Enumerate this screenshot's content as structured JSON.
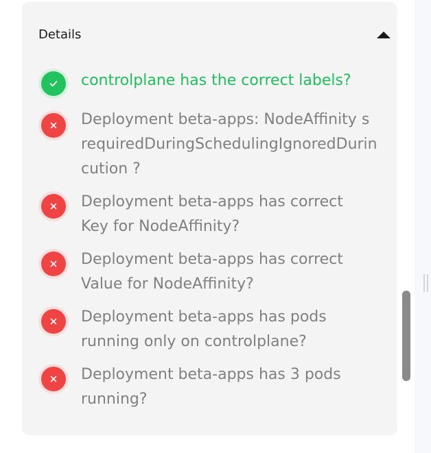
{
  "details": {
    "title": "Details",
    "toggle_icon": "caret-up-icon",
    "colors": {
      "panel_bg": "#f4f4f4",
      "pass": "#22c35e",
      "fail": "#ee4444",
      "muted_text": "#808080"
    },
    "checks": [
      {
        "status": "pass",
        "icon": "check-icon",
        "lines": [
          "controlplane has the correct labels?"
        ]
      },
      {
        "status": "fail",
        "icon": "close-icon",
        "lines": [
          "Deployment beta-apps: NodeAffinity s",
          "requiredDuringSchedulingIgnoredDurin",
          "cution ?"
        ]
      },
      {
        "status": "fail",
        "icon": "close-icon",
        "lines": [
          "Deployment beta-apps has correct",
          "Key for NodeAffinity?"
        ]
      },
      {
        "status": "fail",
        "icon": "close-icon",
        "lines": [
          "Deployment beta-apps has correct",
          "Value for NodeAffinity?"
        ]
      },
      {
        "status": "fail",
        "icon": "close-icon",
        "lines": [
          "Deployment beta-apps has pods",
          "running only on controlplane?"
        ]
      },
      {
        "status": "fail",
        "icon": "close-icon",
        "lines": [
          "Deployment beta-apps has 3 pods",
          "running?"
        ]
      }
    ]
  }
}
